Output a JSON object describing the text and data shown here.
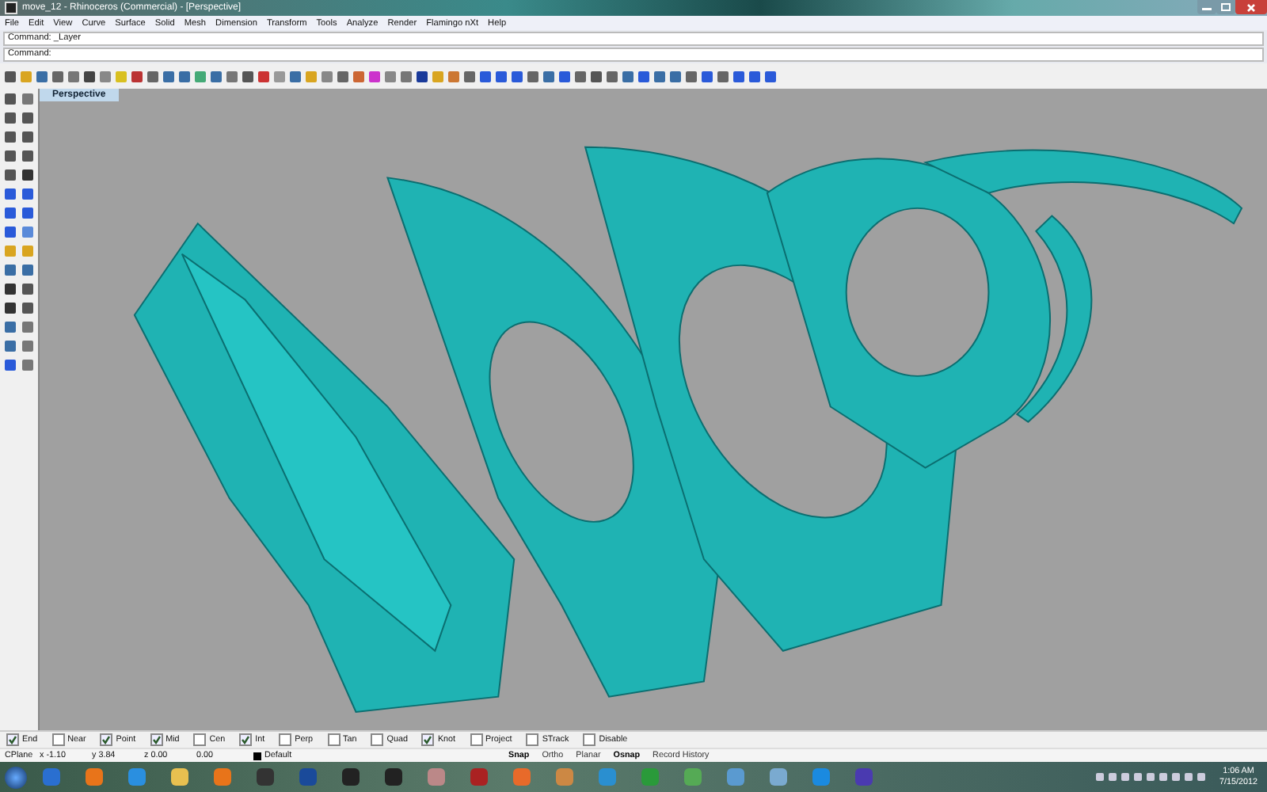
{
  "window": {
    "title": "move_12 - Rhinoceros (Commercial) - [Perspective]"
  },
  "menu": [
    "File",
    "Edit",
    "View",
    "Curve",
    "Surface",
    "Solid",
    "Mesh",
    "Dimension",
    "Transform",
    "Tools",
    "Analyze",
    "Render",
    "Flamingo nXt",
    "Help"
  ],
  "command": {
    "history": "Command: _Layer",
    "prompt": "Command:"
  },
  "viewport": {
    "title": "Perspective"
  },
  "osnaps": [
    {
      "label": "End",
      "checked": true
    },
    {
      "label": "Near",
      "checked": false
    },
    {
      "label": "Point",
      "checked": true
    },
    {
      "label": "Mid",
      "checked": true
    },
    {
      "label": "Cen",
      "checked": false
    },
    {
      "label": "Int",
      "checked": true
    },
    {
      "label": "Perp",
      "checked": false
    },
    {
      "label": "Tan",
      "checked": false
    },
    {
      "label": "Quad",
      "checked": false
    },
    {
      "label": "Knot",
      "checked": true
    },
    {
      "label": "Project",
      "checked": false
    },
    {
      "label": "STrack",
      "checked": false
    },
    {
      "label": "Disable",
      "checked": false
    }
  ],
  "status_bar": {
    "cplane": "CPlane",
    "x": "x -1.10",
    "y": "y 3.84",
    "z": "z 0.00",
    "distance": "0.00",
    "layer": {
      "name": "Default",
      "color": "#000000"
    },
    "toggles": [
      {
        "label": "Snap",
        "on": true
      },
      {
        "label": "Ortho",
        "on": false
      },
      {
        "label": "Planar",
        "on": false
      },
      {
        "label": "Osnap",
        "on": true
      },
      {
        "label": "Record History",
        "on": false
      }
    ]
  },
  "taskbar": {
    "time": "1:06 AM",
    "date": "7/15/2012"
  }
}
